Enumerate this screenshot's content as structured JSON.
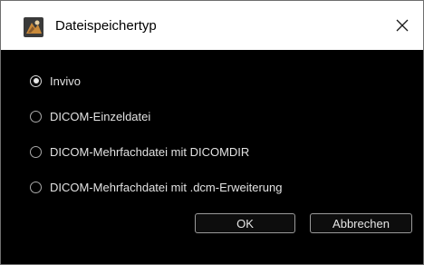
{
  "window": {
    "title": "Dateispeichertyp",
    "icon": "app-logo-icon",
    "close_glyph": "✕"
  },
  "options": [
    {
      "label": "Invivo",
      "checked": true
    },
    {
      "label": "DICOM-Einzeldatei",
      "checked": false
    },
    {
      "label": "DICOM-Mehrfachdatei mit DICOMDIR",
      "checked": false
    },
    {
      "label": "DICOM-Mehrfachdatei mit .dcm-Erweiterung",
      "checked": false
    }
  ],
  "buttons": {
    "ok_label": "OK",
    "cancel_label": "Abbrechen"
  },
  "colors": {
    "background": "#000000",
    "titlebar": "#ffffff",
    "text": "#e2e2e2"
  }
}
